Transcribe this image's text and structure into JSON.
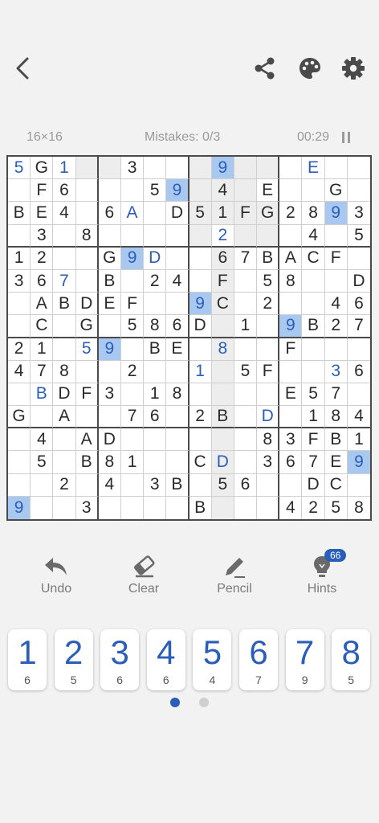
{
  "header": {
    "board_size": "16×16",
    "mistakes": "Mistakes: 0/3",
    "timer": "00:29",
    "icons": [
      "back-arrow-icon",
      "share-icon",
      "palette-icon",
      "gear-icon",
      "pause-icon"
    ]
  },
  "board": {
    "rows": [
      [
        "5",
        "G",
        "1",
        "",
        "",
        "3",
        "",
        "",
        "",
        "9",
        "",
        "",
        "",
        "E",
        "",
        ""
      ],
      [
        "",
        "F",
        "6",
        "",
        "",
        "",
        "5",
        "9",
        "",
        "4",
        "",
        "E",
        "",
        "",
        "G",
        ""
      ],
      [
        "B",
        "E",
        "4",
        "",
        "6",
        "A",
        "",
        "D",
        "5",
        "1",
        "F",
        "G",
        "2",
        "8",
        "9",
        "3"
      ],
      [
        "",
        "3",
        "",
        "8",
        "",
        "",
        "",
        "",
        "",
        "2",
        "",
        "",
        "",
        "4",
        "",
        "5"
      ],
      [
        "1",
        "2",
        "",
        "",
        "G",
        "9",
        "D",
        "",
        "",
        "6",
        "7",
        "B",
        "A",
        "C",
        "F",
        ""
      ],
      [
        "3",
        "6",
        "7",
        "",
        "B",
        "",
        "2",
        "4",
        "",
        "F",
        "",
        "5",
        "8",
        "",
        "",
        "D"
      ],
      [
        "",
        "A",
        "B",
        "D",
        "E",
        "F",
        "",
        "",
        "9",
        "C",
        "",
        "2",
        "",
        "",
        "4",
        "6"
      ],
      [
        "",
        "C",
        "",
        "G",
        "",
        "5",
        "8",
        "6",
        "D",
        "",
        "1",
        "",
        "9",
        "B",
        "2",
        "7"
      ],
      [
        "2",
        "1",
        "",
        "5",
        "9",
        "",
        "B",
        "E",
        "",
        "8",
        "",
        "",
        "F",
        "",
        "",
        ""
      ],
      [
        "4",
        "7",
        "8",
        "",
        "",
        "2",
        "",
        "",
        "1",
        "",
        "5",
        "F",
        "",
        "",
        "3",
        "6"
      ],
      [
        "",
        "B",
        "D",
        "F",
        "3",
        "",
        "1",
        "8",
        "",
        "",
        "",
        "",
        "E",
        "5",
        "7",
        ""
      ],
      [
        "G",
        "",
        "A",
        "",
        "",
        "7",
        "6",
        "",
        "2",
        "B",
        "",
        "D",
        "",
        "1",
        "8",
        "4"
      ],
      [
        "",
        "4",
        "",
        "A",
        "D",
        "",
        "",
        "",
        "",
        "",
        "",
        "8",
        "3",
        "F",
        "B",
        "1"
      ],
      [
        "",
        "5",
        "",
        "B",
        "8",
        "1",
        "",
        "",
        "C",
        "D",
        "",
        "3",
        "6",
        "7",
        "E",
        "9"
      ],
      [
        "",
        "",
        "2",
        "",
        "4",
        "",
        "3",
        "B",
        "",
        "5",
        "6",
        "",
        "",
        "D",
        "C",
        ""
      ],
      [
        "9",
        "",
        "",
        "3",
        "",
        "",
        "",
        "",
        "B",
        "",
        "",
        "",
        "4",
        "2",
        "5",
        "8"
      ]
    ],
    "user_cells": [
      "0,0",
      "0,2",
      "0,9",
      "0,13",
      "1,7",
      "2,5",
      "2,14",
      "3,9",
      "4,5",
      "4,6",
      "5,2",
      "6,8",
      "7,12",
      "8,3",
      "8,4",
      "8,9",
      "9,8",
      "9,14",
      "10,1",
      "11,11",
      "13,9",
      "13,15",
      "15,0"
    ],
    "selected_cells": [
      "0,9",
      "1,7",
      "2,14",
      "4,5",
      "6,8",
      "7,12",
      "8,4",
      "13,15",
      "15,0"
    ],
    "highlight_cells": [
      "0,3",
      "0,4",
      "0,8",
      "0,10",
      "0,11",
      "1,8",
      "1,10",
      "1,9",
      "2,8",
      "2,9",
      "2,10",
      "2,11",
      "3,8",
      "3,10",
      "3,11",
      "4,9",
      "5,9",
      "6,9",
      "7,9",
      "8,9",
      "9,9",
      "10,9",
      "11,9",
      "12,9",
      "13,9",
      "14,9",
      "15,9"
    ]
  },
  "tools": {
    "undo": "Undo",
    "clear": "Clear",
    "pencil": "Pencil",
    "hints": "Hints",
    "hints_count": "66"
  },
  "keypad": {
    "keys": [
      {
        "digit": "1",
        "count": "6"
      },
      {
        "digit": "2",
        "count": "5"
      },
      {
        "digit": "3",
        "count": "6"
      },
      {
        "digit": "4",
        "count": "6"
      },
      {
        "digit": "5",
        "count": "4"
      },
      {
        "digit": "6",
        "count": "7"
      },
      {
        "digit": "7",
        "count": "9"
      },
      {
        "digit": "8",
        "count": "5"
      }
    ],
    "page_count": 2,
    "active_page": 0
  },
  "colors": {
    "accent": "#2b5eb8",
    "selected_cell": "#a9c8ef",
    "highlight_cell": "#ededed",
    "icon": "#4a4a4a",
    "background": "#f2f2f2"
  }
}
